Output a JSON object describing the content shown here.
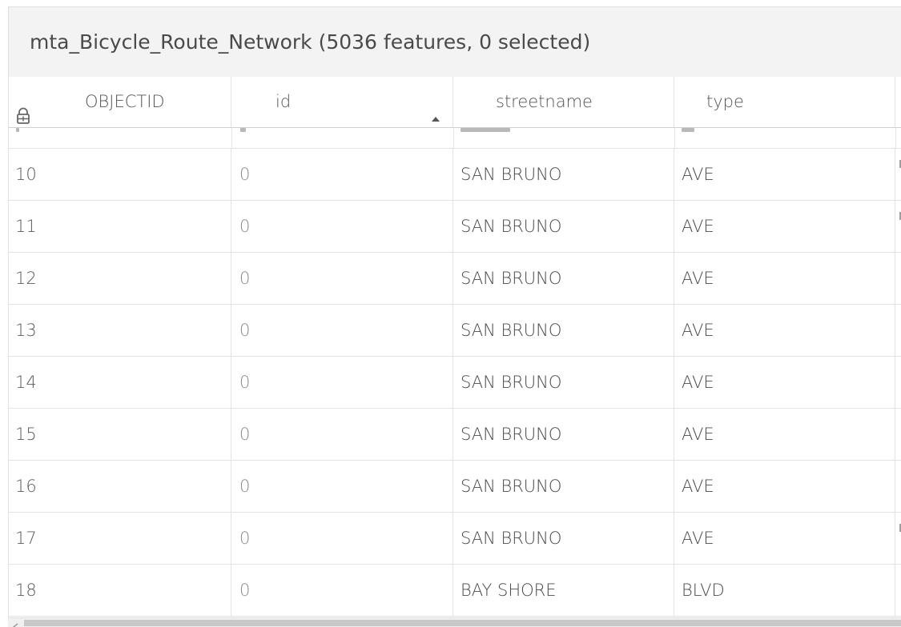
{
  "window": {
    "title": "mta_Bicycle_Route_Network (5036 features, 0 selected)"
  },
  "table": {
    "columns": [
      {
        "label": "OBJECTID"
      },
      {
        "label": "id"
      },
      {
        "label": "streetname"
      },
      {
        "label": "type"
      }
    ],
    "sort": {
      "column": "id",
      "direction": "ascending"
    },
    "rows": [
      {
        "objectid": "10",
        "id": "0",
        "streetname": "SAN BRUNO",
        "type": "AVE"
      },
      {
        "objectid": "11",
        "id": "0",
        "streetname": "SAN BRUNO",
        "type": "AVE"
      },
      {
        "objectid": "12",
        "id": "0",
        "streetname": "SAN BRUNO",
        "type": "AVE"
      },
      {
        "objectid": "13",
        "id": "0",
        "streetname": "SAN BRUNO",
        "type": "AVE"
      },
      {
        "objectid": "14",
        "id": "0",
        "streetname": "SAN BRUNO",
        "type": "AVE"
      },
      {
        "objectid": "15",
        "id": "0",
        "streetname": "SAN BRUNO",
        "type": "AVE"
      },
      {
        "objectid": "16",
        "id": "0",
        "streetname": "SAN BRUNO",
        "type": "AVE"
      },
      {
        "objectid": "17",
        "id": "0",
        "streetname": "SAN BRUNO",
        "type": "AVE"
      },
      {
        "objectid": "18",
        "id": "0",
        "streetname": "BAY SHORE",
        "type": "BLVD"
      }
    ]
  },
  "icons": {
    "lock": "lock-icon",
    "sort": "sort-ascending-icon",
    "scroll_left": "chevron-left-icon"
  },
  "colors": {
    "title_bar_bg": "#f3f3f3",
    "grid_line": "#e3e3e3",
    "text": "#4a4a4a",
    "muted_text": "#8a8a8a",
    "scroll_thumb": "#c8c8c8"
  }
}
